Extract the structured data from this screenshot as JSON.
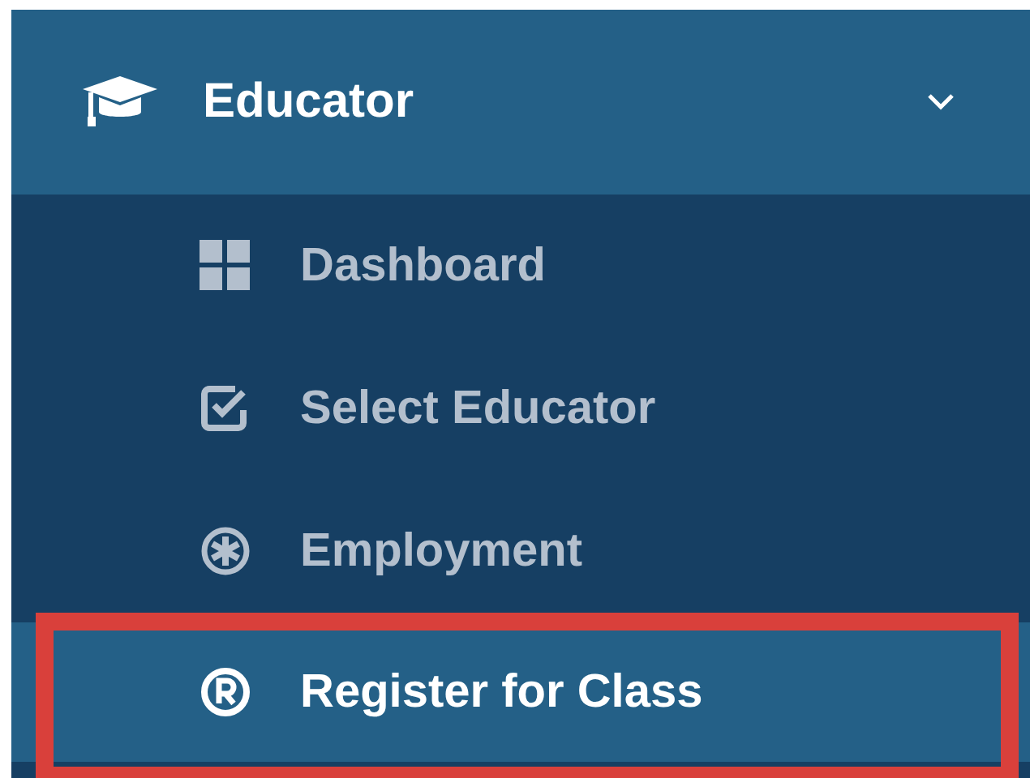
{
  "menu": {
    "label": "Educator",
    "expanded": true,
    "items": [
      {
        "label": "Dashboard",
        "selected": false,
        "highlighted": false
      },
      {
        "label": "Select Educator",
        "selected": false,
        "highlighted": false
      },
      {
        "label": "Employment",
        "selected": false,
        "highlighted": false
      },
      {
        "label": "Register for Class",
        "selected": true,
        "highlighted": true
      }
    ]
  }
}
